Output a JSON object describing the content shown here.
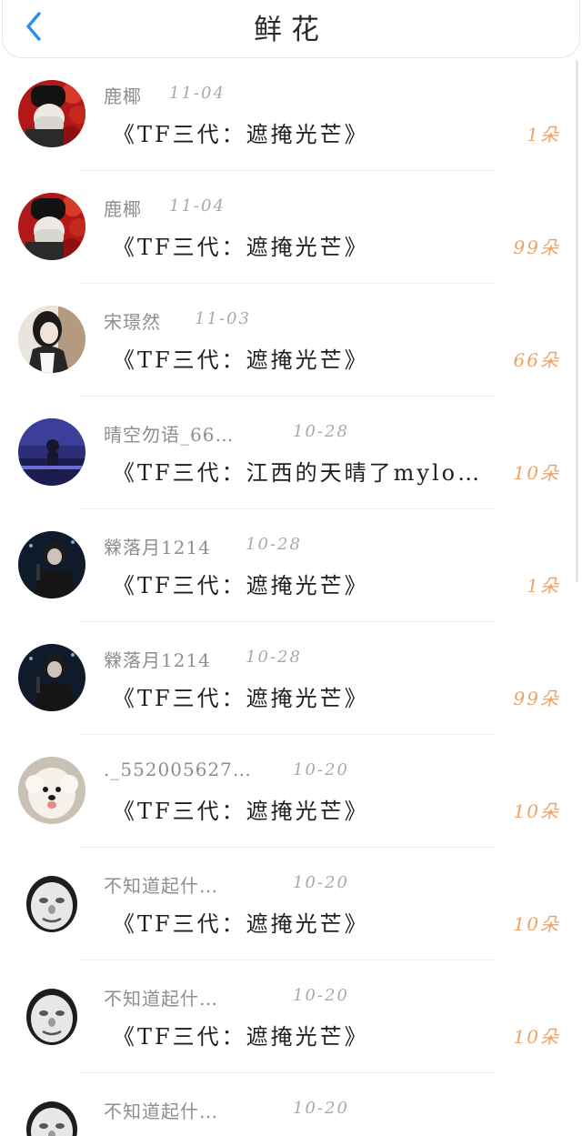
{
  "header": {
    "title": "鲜花",
    "back_icon": "chevron-left-icon"
  },
  "colors": {
    "back_icon": "#2d8cf0",
    "count": "#e9a46b",
    "username": "#8e8e8e",
    "date": "#a9a9a9"
  },
  "rows": [
    {
      "username": "鹿椰",
      "date": "11-04",
      "song": "《TF三代：遮掩光芒》",
      "count": "1朵",
      "avatar": "red-hat-selfie"
    },
    {
      "username": "鹿椰",
      "date": "11-04",
      "song": "《TF三代：遮掩光芒》",
      "count": "99朵",
      "avatar": "red-hat-selfie"
    },
    {
      "username": "宋璟然",
      "date": "11-03",
      "song": "《TF三代：遮掩光芒》",
      "count": "66朵",
      "avatar": "girl-portrait"
    },
    {
      "username": "晴空勿语_66…",
      "date": "10-28",
      "song": "《TF三代：江西的天晴了mylo…",
      "count": "10朵",
      "avatar": "stage-blue"
    },
    {
      "username": "檾落月1214",
      "date": "10-28",
      "song": "《TF三代：遮掩光芒》",
      "count": "1朵",
      "avatar": "singer-dark"
    },
    {
      "username": "檾落月1214",
      "date": "10-28",
      "song": "《TF三代：遮掩光芒》",
      "count": "99朵",
      "avatar": "singer-dark"
    },
    {
      "username": "._552005627…",
      "date": "10-20",
      "song": "《TF三代：遮掩光芒》",
      "count": "10朵",
      "avatar": "white-dog"
    },
    {
      "username": "不知道起什…",
      "date": "10-20",
      "song": "《TF三代：遮掩光芒》",
      "count": "10朵",
      "avatar": "meme-face"
    },
    {
      "username": "不知道起什…",
      "date": "10-20",
      "song": "《TF三代：遮掩光芒》",
      "count": "10朵",
      "avatar": "meme-face"
    },
    {
      "username": "不知道起什…",
      "date": "10-20",
      "song": "",
      "count": "",
      "avatar": "meme-face"
    }
  ]
}
